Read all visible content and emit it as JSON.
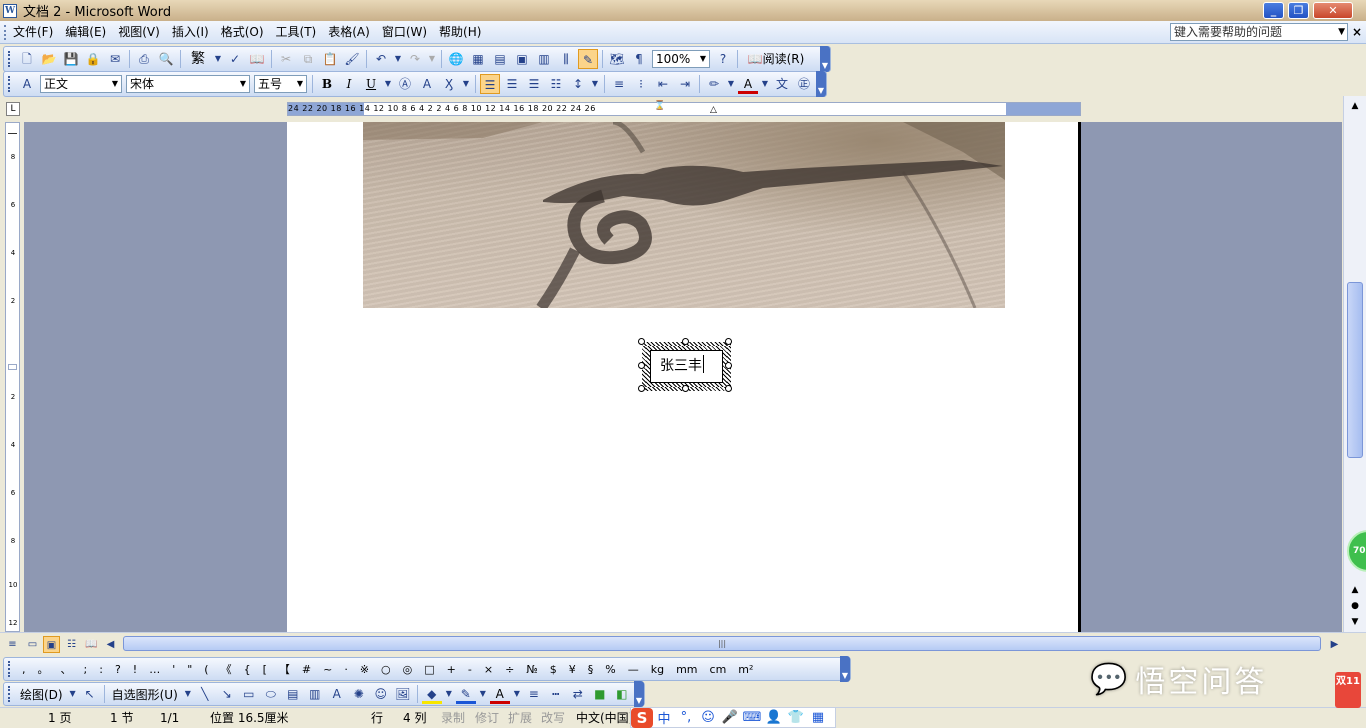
{
  "window": {
    "title": "文档 2 - Microsoft Word",
    "icon": "word-doc-icon",
    "controls": [
      "minimize",
      "restore",
      "close"
    ]
  },
  "menubar": {
    "items": [
      "文件(F)",
      "编辑(E)",
      "视图(V)",
      "插入(I)",
      "格式(O)",
      "工具(T)",
      "表格(A)",
      "窗口(W)",
      "帮助(H)"
    ],
    "help_placeholder": "键入需要帮助的问题"
  },
  "standard_toolbar": {
    "traditional_label": "繁",
    "zoom": "100%",
    "read_label": "阅读(R)"
  },
  "formatting_toolbar": {
    "style": "正文",
    "font": "宋体",
    "size": "五号",
    "bold": "B",
    "italic": "I",
    "underline": "U"
  },
  "ruler": {
    "labels": "24   22   20   18   16   14   12   10   8    6    4    2         2    4    6    8    10   12   14   16   18   20   22   24   26"
  },
  "document": {
    "textbox_text": "张三丰"
  },
  "symbol_toolbar": {
    "symbols": [
      ",",
      "。",
      "、",
      ";",
      ":",
      "?",
      "!",
      "…",
      "'",
      "\"",
      "(",
      "《",
      "{",
      "[",
      "【",
      "#",
      "~",
      "·",
      "※",
      "○",
      "◎",
      "□",
      "+",
      "-",
      "×",
      "÷",
      "№",
      "$",
      "¥",
      "§",
      "%",
      "—",
      "kg",
      "mm",
      "cm",
      "m²"
    ]
  },
  "drawing_toolbar": {
    "draw_label": "绘图(D)",
    "autoshape_label": "自选图形(U)"
  },
  "statusbar": {
    "page": "1 页",
    "section": "1 节",
    "page_of": "1/1",
    "position": "位置 16.5厘米",
    "line": "行",
    "column": "4 列",
    "record": "录制",
    "revise": "修订",
    "extend": "扩展",
    "overtype": "改写",
    "language": "中文(中国)"
  },
  "ime": {
    "logo": "S",
    "mode": "中"
  },
  "watermark": {
    "text": "悟空问答"
  },
  "badges": {
    "green": "70",
    "corner": "双11"
  }
}
